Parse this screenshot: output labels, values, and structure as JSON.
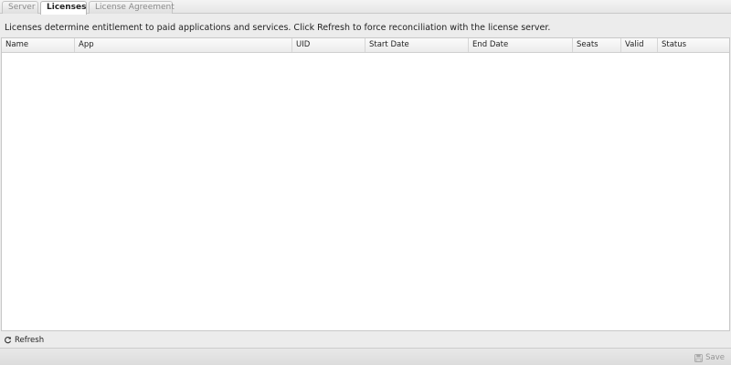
{
  "tabs": [
    {
      "label": "Server",
      "active": false
    },
    {
      "label": "Licenses",
      "active": true
    },
    {
      "label": "License Agreement",
      "active": false
    }
  ],
  "description": "Licenses determine entitlement to paid applications and services. Click Refresh to force reconciliation with the license server.",
  "grid": {
    "columns": [
      "Name",
      "App",
      "UID",
      "Start Date",
      "End Date",
      "Seats",
      "Valid",
      "Status"
    ],
    "rows": []
  },
  "toolbar": {
    "refresh_label": "Refresh",
    "refresh_icon": "refresh-icon"
  },
  "footer": {
    "save_label": "Save",
    "save_icon": "floppy-disk-icon",
    "save_enabled": false
  },
  "colors": {
    "background": "#ececec",
    "grid_background": "#ffffff",
    "border": "#c8c8c8",
    "text": "#222222",
    "muted_text": "#8a8a8a"
  }
}
